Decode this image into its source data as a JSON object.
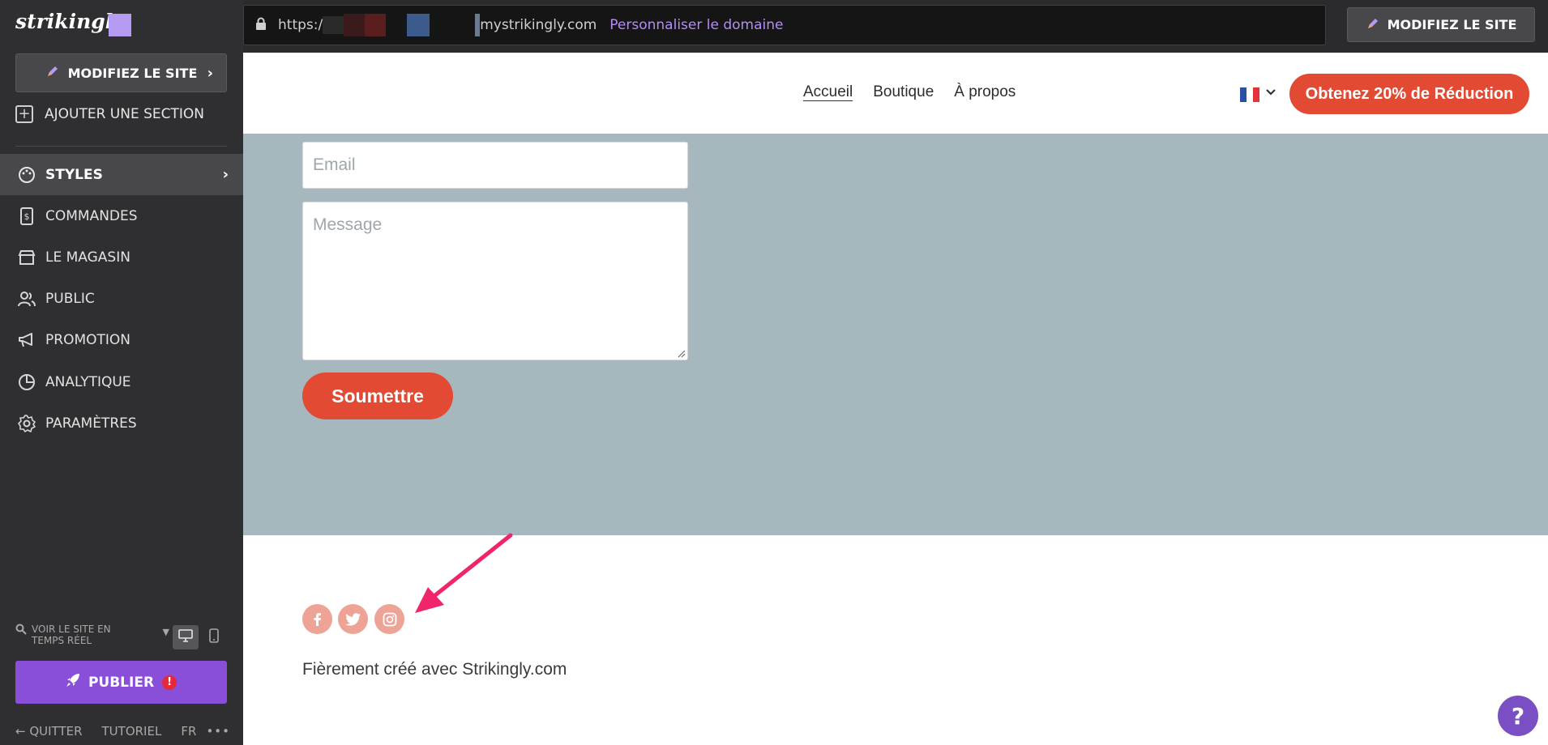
{
  "sidebar": {
    "logo_text": "strikingly",
    "edit_site_label": "MODIFIEZ LE SITE",
    "add_section_label": "AJOUTER UNE SECTION",
    "items": [
      {
        "label": "STYLES"
      },
      {
        "label": "COMMANDES"
      },
      {
        "label": "LE MAGASIN"
      },
      {
        "label": "PUBLIC"
      },
      {
        "label": "PROMOTION"
      },
      {
        "label": "ANALYTIQUE"
      },
      {
        "label": "PARAMÈTRES"
      }
    ],
    "live_view_label": "VOIR LE SITE EN TEMPS RÉEL",
    "publish_label": "PUBLIER",
    "publish_alert": "!",
    "footer": {
      "quit": "QUITTER",
      "tutorial": "TUTORIEL",
      "language": "FR",
      "more": "•••"
    }
  },
  "topbar": {
    "url_prefix": "https:/",
    "url_suffix": "mystrikingly.com",
    "custom_domain_link": "Personnaliser le domaine",
    "edit_site_label": "MODIFIEZ LE SITE"
  },
  "site": {
    "nav_links": [
      "Accueil",
      "Boutique",
      "À propos"
    ],
    "promo_button": "Obtenez 20% de Réduction",
    "form": {
      "email_placeholder": "Email",
      "message_placeholder": "Message",
      "submit_label": "Soumettre"
    },
    "credit": "Fièrement créé avec Strikingly.com",
    "help_label": "?"
  },
  "colors": {
    "sidebar_bg": "#2f2f31",
    "accent_purple": "#8a4fd9",
    "brand_red": "#e24a33",
    "form_section_bg": "#a6b8be",
    "social_icon_bg": "#eea397",
    "arrow": "#f0256b"
  }
}
